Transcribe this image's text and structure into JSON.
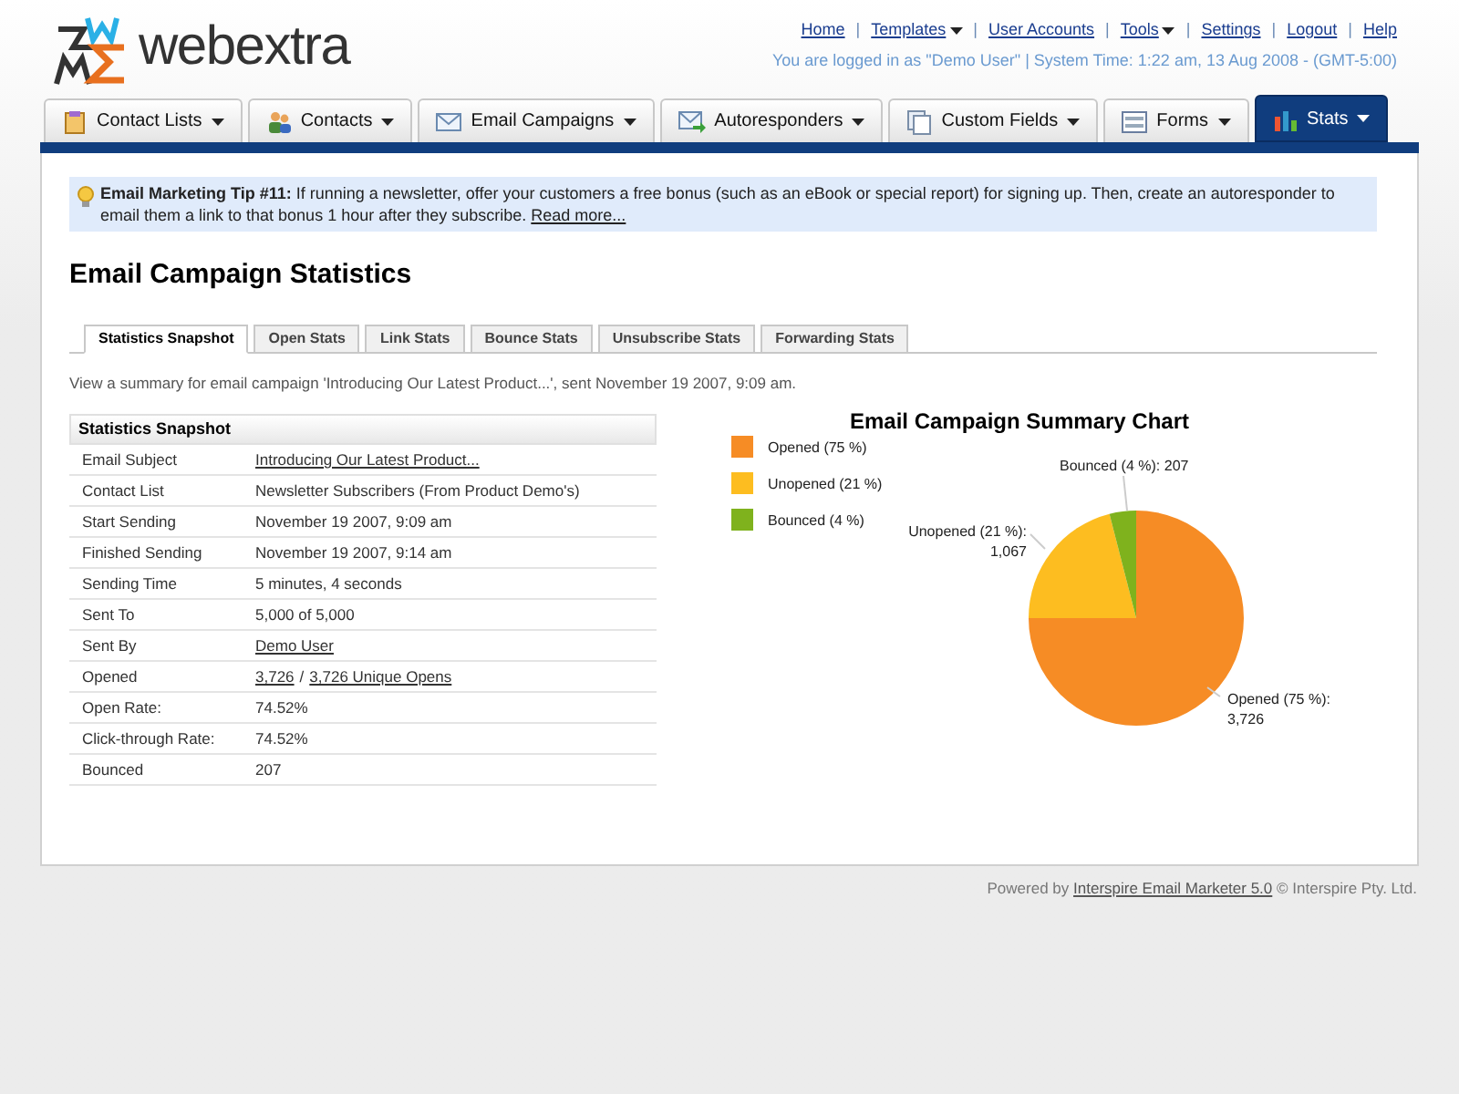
{
  "logo": {
    "text": "webextra"
  },
  "link_separator": "|",
  "top_links": [
    {
      "label": "Home",
      "menu": false
    },
    {
      "label": "Templates",
      "menu": true
    },
    {
      "label": "User Accounts",
      "menu": false
    },
    {
      "label": "Tools",
      "menu": true
    },
    {
      "label": "Settings",
      "menu": false
    },
    {
      "label": "Logout",
      "menu": false
    },
    {
      "label": "Help",
      "menu": false
    }
  ],
  "login_info": "You are logged in as \"Demo User\" | System Time: 1:22 am, 13 Aug 2008 - (GMT-5:00)",
  "tabs": [
    {
      "label": "Contact Lists",
      "selected": false
    },
    {
      "label": "Contacts",
      "selected": false
    },
    {
      "label": "Email Campaigns",
      "selected": false
    },
    {
      "label": "Autoresponders",
      "selected": false
    },
    {
      "label": "Custom Fields",
      "selected": false
    },
    {
      "label": "Forms",
      "selected": false
    },
    {
      "label": "Stats",
      "selected": true
    }
  ],
  "tip": {
    "text": "**Email Marketing Tip #11:** If running a newsletter, offer your customers a free bonus (such as an eBook or special report) for signing up. Then, create an autoresponder to email them a link to that bonus 1 hour after they subscribe.",
    "link": "Read more..."
  },
  "heading": "Email Campaign Statistics",
  "sub_tabs": [
    {
      "label": "Statistics Snapshot",
      "selected": true
    },
    {
      "label": "Open Stats",
      "selected": false
    },
    {
      "label": "Link Stats",
      "selected": false
    },
    {
      "label": "Bounce Stats",
      "selected": false
    },
    {
      "label": "Unsubscribe Stats",
      "selected": false
    },
    {
      "label": "Forwarding Stats",
      "selected": false
    }
  ],
  "description": "View a summary for email campaign 'Introducing Our Latest Product...', sent November 19 2007, 9:09 am.",
  "snapshot": {
    "title": "Statistics Snapshot",
    "rows": [
      {
        "label": "Email Subject",
        "value": [
          {
            "text": "Introducing Our Latest Product...",
            "link": true
          }
        ]
      },
      {
        "label": "Contact List",
        "value": [
          {
            "text": "Newsletter Subscribers (From Product Demo's)",
            "link": false
          }
        ]
      },
      {
        "label": "Start Sending",
        "value": [
          {
            "text": "November 19 2007, 9:09 am",
            "link": false
          }
        ]
      },
      {
        "label": "Finished Sending",
        "value": [
          {
            "text": "November 19 2007, 9:14 am",
            "link": false
          }
        ]
      },
      {
        "label": "Sending Time",
        "value": [
          {
            "text": "5 minutes, 4 seconds",
            "link": false
          }
        ]
      },
      {
        "label": "Sent To",
        "value": [
          {
            "text": "5,000 of 5,000",
            "link": false
          }
        ]
      },
      {
        "label": "Sent By",
        "value": [
          {
            "text": "Demo User",
            "link": true
          }
        ]
      },
      {
        "label": "Opened",
        "value": [
          {
            "text": "3,726",
            "link": true
          },
          {
            "text": "/",
            "link": false
          },
          {
            "text": "3,726 Unique Opens",
            "link": true
          }
        ]
      },
      {
        "label": "Open Rate:",
        "value": [
          {
            "text": "74.52%",
            "link": false
          }
        ]
      },
      {
        "label": "Click-through Rate:",
        "value": [
          {
            "text": "74.52%",
            "link": false
          }
        ]
      },
      {
        "label": "Bounced",
        "value": [
          {
            "text": "207",
            "link": false
          }
        ]
      }
    ]
  },
  "chart": {
    "chart_data": {
      "type": "pie",
      "title": "Email Campaign Summary Chart",
      "categories": [
        "Opened (75 %)",
        "Unopened (21 %)",
        "Bounced (4 %)"
      ],
      "series": [
        {
          "values": [
            75,
            21,
            4
          ]
        }
      ],
      "legend": true,
      "colors": [
        "#f68c25",
        "#fdbd20",
        "#7fb21d"
      ],
      "value_labels": [
        "Opened (75 %):\n3,726",
        "Unopened (21 %):\n1,067",
        "Bounced (4 %): 207"
      ]
    }
  },
  "footer": {
    "before": "Powered by",
    "link": "Interspire Email Marketer 5.0",
    "after": "© Interspire Pty. Ltd."
  }
}
